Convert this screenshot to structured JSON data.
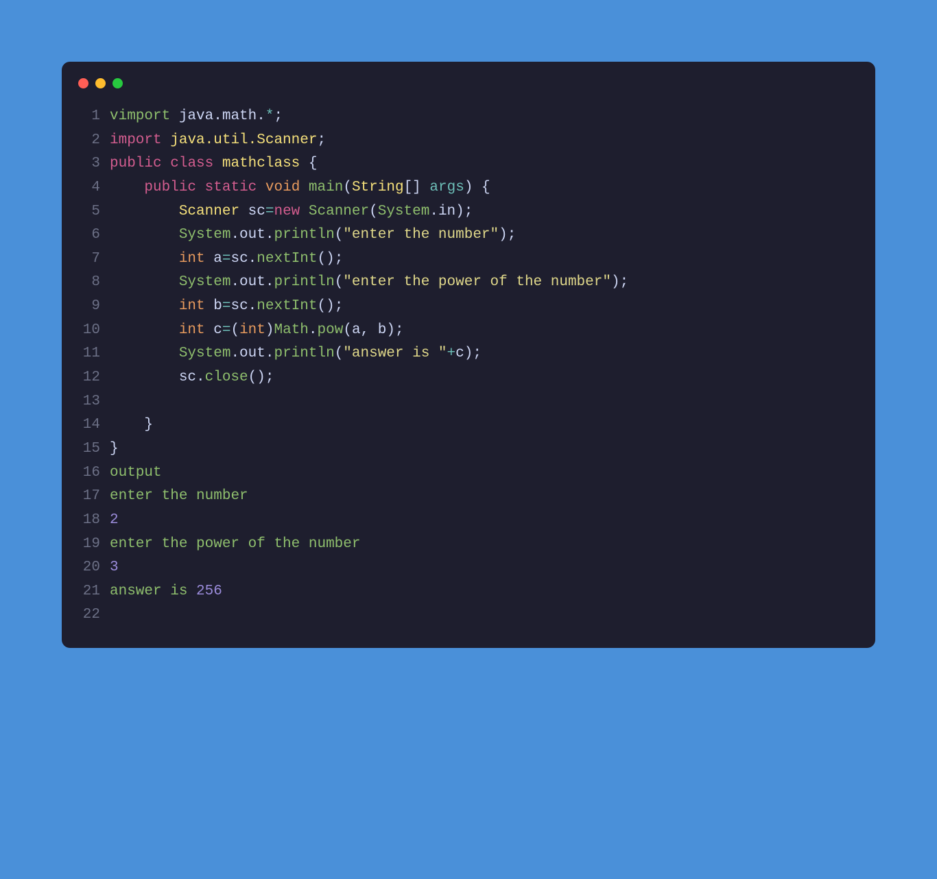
{
  "traffic_lights": {
    "red": "#ff5f56",
    "yellow": "#ffbd2e",
    "green": "#27c93f"
  },
  "code": {
    "lines": [
      {
        "num": "1",
        "tokens": [
          {
            "t": "vimport",
            "c": "kw-green"
          },
          {
            "t": " java",
            "c": "kw-white"
          },
          {
            "t": ".",
            "c": "kw-white"
          },
          {
            "t": "math",
            "c": "kw-white"
          },
          {
            "t": ".",
            "c": "kw-white"
          },
          {
            "t": "*",
            "c": "kw-teal"
          },
          {
            "t": ";",
            "c": "kw-white"
          }
        ]
      },
      {
        "num": "2",
        "tokens": [
          {
            "t": "import",
            "c": "kw-pink"
          },
          {
            "t": " ",
            "c": "kw-white"
          },
          {
            "t": "java.util.Scanner",
            "c": "kw-yellow"
          },
          {
            "t": ";",
            "c": "kw-white"
          }
        ]
      },
      {
        "num": "3",
        "tokens": [
          {
            "t": "public",
            "c": "kw-pink"
          },
          {
            "t": " ",
            "c": "kw-white"
          },
          {
            "t": "class",
            "c": "kw-pink"
          },
          {
            "t": " ",
            "c": "kw-white"
          },
          {
            "t": "mathclass",
            "c": "kw-yellow"
          },
          {
            "t": " {",
            "c": "kw-white"
          }
        ]
      },
      {
        "num": "4",
        "tokens": [
          {
            "t": "    ",
            "c": "kw-white"
          },
          {
            "t": "public",
            "c": "kw-pink"
          },
          {
            "t": " ",
            "c": "kw-white"
          },
          {
            "t": "static",
            "c": "kw-pink"
          },
          {
            "t": " ",
            "c": "kw-white"
          },
          {
            "t": "void",
            "c": "kw-orange"
          },
          {
            "t": " ",
            "c": "kw-white"
          },
          {
            "t": "main",
            "c": "kw-green"
          },
          {
            "t": "(",
            "c": "kw-white"
          },
          {
            "t": "String",
            "c": "kw-yellow"
          },
          {
            "t": "[] ",
            "c": "kw-white"
          },
          {
            "t": "args",
            "c": "kw-teal"
          },
          {
            "t": ") {",
            "c": "kw-white"
          }
        ]
      },
      {
        "num": "5",
        "tokens": [
          {
            "t": "        ",
            "c": "kw-white"
          },
          {
            "t": "Scanner",
            "c": "kw-yellow"
          },
          {
            "t": " sc",
            "c": "kw-white"
          },
          {
            "t": "=",
            "c": "kw-teal"
          },
          {
            "t": "new",
            "c": "kw-pink"
          },
          {
            "t": " ",
            "c": "kw-white"
          },
          {
            "t": "Scanner",
            "c": "kw-green"
          },
          {
            "t": "(",
            "c": "kw-white"
          },
          {
            "t": "System",
            "c": "kw-green"
          },
          {
            "t": ".in);",
            "c": "kw-white"
          }
        ]
      },
      {
        "num": "6",
        "tokens": [
          {
            "t": "        ",
            "c": "kw-white"
          },
          {
            "t": "System",
            "c": "kw-green"
          },
          {
            "t": ".out.",
            "c": "kw-white"
          },
          {
            "t": "println",
            "c": "kw-green"
          },
          {
            "t": "(",
            "c": "kw-white"
          },
          {
            "t": "\"enter the number\"",
            "c": "kw-string"
          },
          {
            "t": ");",
            "c": "kw-white"
          }
        ]
      },
      {
        "num": "7",
        "tokens": [
          {
            "t": "        ",
            "c": "kw-white"
          },
          {
            "t": "int",
            "c": "kw-orange"
          },
          {
            "t": " a",
            "c": "kw-white"
          },
          {
            "t": "=",
            "c": "kw-teal"
          },
          {
            "t": "sc.",
            "c": "kw-white"
          },
          {
            "t": "nextInt",
            "c": "kw-green"
          },
          {
            "t": "();",
            "c": "kw-white"
          }
        ]
      },
      {
        "num": "8",
        "tokens": [
          {
            "t": "        ",
            "c": "kw-white"
          },
          {
            "t": "System",
            "c": "kw-green"
          },
          {
            "t": ".out.",
            "c": "kw-white"
          },
          {
            "t": "println",
            "c": "kw-green"
          },
          {
            "t": "(",
            "c": "kw-white"
          },
          {
            "t": "\"enter the power of the number\"",
            "c": "kw-string"
          },
          {
            "t": ");",
            "c": "kw-white"
          }
        ]
      },
      {
        "num": "9",
        "tokens": [
          {
            "t": "        ",
            "c": "kw-white"
          },
          {
            "t": "int",
            "c": "kw-orange"
          },
          {
            "t": " b",
            "c": "kw-white"
          },
          {
            "t": "=",
            "c": "kw-teal"
          },
          {
            "t": "sc.",
            "c": "kw-white"
          },
          {
            "t": "nextInt",
            "c": "kw-green"
          },
          {
            "t": "();",
            "c": "kw-white"
          }
        ]
      },
      {
        "num": "10",
        "tokens": [
          {
            "t": "        ",
            "c": "kw-white"
          },
          {
            "t": "int",
            "c": "kw-orange"
          },
          {
            "t": " c",
            "c": "kw-white"
          },
          {
            "t": "=",
            "c": "kw-teal"
          },
          {
            "t": "(",
            "c": "kw-white"
          },
          {
            "t": "int",
            "c": "kw-orange"
          },
          {
            "t": ")",
            "c": "kw-white"
          },
          {
            "t": "Math",
            "c": "kw-green"
          },
          {
            "t": ".",
            "c": "kw-white"
          },
          {
            "t": "pow",
            "c": "kw-green"
          },
          {
            "t": "(a, b);",
            "c": "kw-white"
          }
        ]
      },
      {
        "num": "11",
        "tokens": [
          {
            "t": "        ",
            "c": "kw-white"
          },
          {
            "t": "System",
            "c": "kw-green"
          },
          {
            "t": ".out.",
            "c": "kw-white"
          },
          {
            "t": "println",
            "c": "kw-green"
          },
          {
            "t": "(",
            "c": "kw-white"
          },
          {
            "t": "\"answer is \"",
            "c": "kw-string"
          },
          {
            "t": "+",
            "c": "kw-teal"
          },
          {
            "t": "c);",
            "c": "kw-white"
          }
        ]
      },
      {
        "num": "12",
        "tokens": [
          {
            "t": "        sc.",
            "c": "kw-white"
          },
          {
            "t": "close",
            "c": "kw-green"
          },
          {
            "t": "();",
            "c": "kw-white"
          }
        ]
      },
      {
        "num": "13",
        "tokens": [
          {
            "t": "        ",
            "c": "kw-white"
          }
        ]
      },
      {
        "num": "14",
        "tokens": [
          {
            "t": "    }",
            "c": "kw-white"
          }
        ]
      },
      {
        "num": "15",
        "tokens": [
          {
            "t": "}",
            "c": "kw-white"
          }
        ]
      },
      {
        "num": "16",
        "tokens": [
          {
            "t": "output",
            "c": "kw-green"
          }
        ]
      },
      {
        "num": "17",
        "tokens": [
          {
            "t": "enter the ",
            "c": "kw-green"
          },
          {
            "t": "number",
            "c": "kw-green"
          }
        ]
      },
      {
        "num": "18",
        "tokens": [
          {
            "t": "2",
            "c": "kw-purple"
          }
        ]
      },
      {
        "num": "19",
        "tokens": [
          {
            "t": "enter the power of the ",
            "c": "kw-green"
          },
          {
            "t": "number",
            "c": "kw-green"
          }
        ]
      },
      {
        "num": "20",
        "tokens": [
          {
            "t": "3",
            "c": "kw-purple"
          }
        ]
      },
      {
        "num": "21",
        "tokens": [
          {
            "t": "answer is ",
            "c": "kw-green"
          },
          {
            "t": "256",
            "c": "kw-purple"
          }
        ]
      },
      {
        "num": "22",
        "tokens": [
          {
            "t": "",
            "c": "kw-white"
          }
        ]
      }
    ]
  }
}
